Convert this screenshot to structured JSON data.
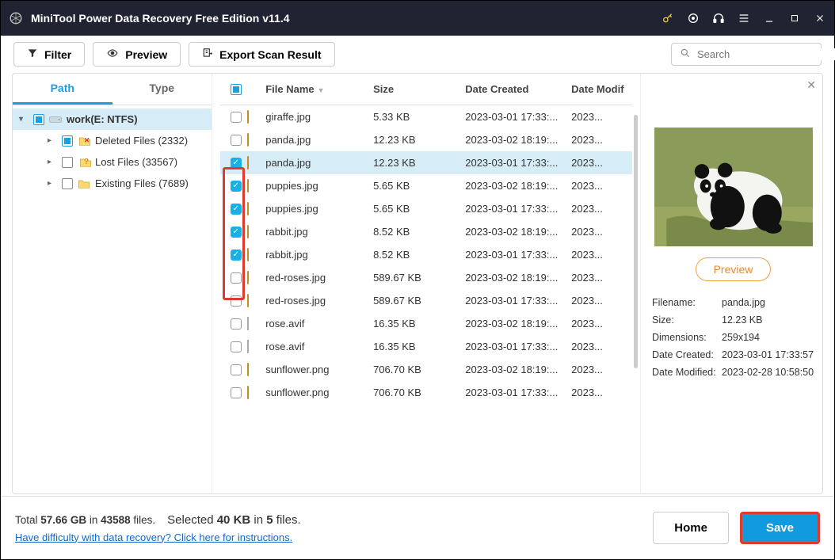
{
  "title": "MiniTool Power Data Recovery Free Edition v11.4",
  "toolbar": {
    "filter": "Filter",
    "preview": "Preview",
    "export": "Export Scan Result"
  },
  "search": {
    "placeholder": "Search"
  },
  "tabs": {
    "path": "Path",
    "type": "Type"
  },
  "tree": {
    "root": "work(E: NTFS)",
    "deleted": "Deleted Files (2332)",
    "lost": "Lost Files (33567)",
    "existing": "Existing Files (7689)"
  },
  "cols": {
    "name": "File Name",
    "size": "Size",
    "created": "Date Created",
    "modified": "Date Modif"
  },
  "files": [
    {
      "name": "giraffe.jpg",
      "size": "5.33 KB",
      "created": "2023-03-01 17:33:...",
      "modified": "2023...",
      "type": "img",
      "checked": false,
      "sel": false
    },
    {
      "name": "panda.jpg",
      "size": "12.23 KB",
      "created": "2023-03-02 18:19:...",
      "modified": "2023...",
      "type": "img",
      "checked": false,
      "sel": false
    },
    {
      "name": "panda.jpg",
      "size": "12.23 KB",
      "created": "2023-03-01 17:33:...",
      "modified": "2023...",
      "type": "img",
      "checked": true,
      "sel": true
    },
    {
      "name": "puppies.jpg",
      "size": "5.65 KB",
      "created": "2023-03-02 18:19:...",
      "modified": "2023...",
      "type": "img",
      "checked": true,
      "sel": false
    },
    {
      "name": "puppies.jpg",
      "size": "5.65 KB",
      "created": "2023-03-01 17:33:...",
      "modified": "2023...",
      "type": "img",
      "checked": true,
      "sel": false
    },
    {
      "name": "rabbit.jpg",
      "size": "8.52 KB",
      "created": "2023-03-02 18:19:...",
      "modified": "2023...",
      "type": "img",
      "checked": true,
      "sel": false
    },
    {
      "name": "rabbit.jpg",
      "size": "8.52 KB",
      "created": "2023-03-01 17:33:...",
      "modified": "2023...",
      "type": "img",
      "checked": true,
      "sel": false
    },
    {
      "name": "red-roses.jpg",
      "size": "589.67 KB",
      "created": "2023-03-02 18:19:...",
      "modified": "2023...",
      "type": "img",
      "checked": false,
      "sel": false
    },
    {
      "name": "red-roses.jpg",
      "size": "589.67 KB",
      "created": "2023-03-01 17:33:...",
      "modified": "2023...",
      "type": "img",
      "checked": false,
      "sel": false
    },
    {
      "name": "rose.avif",
      "size": "16.35 KB",
      "created": "2023-03-02 18:19:...",
      "modified": "2023...",
      "type": "doc",
      "checked": false,
      "sel": false
    },
    {
      "name": "rose.avif",
      "size": "16.35 KB",
      "created": "2023-03-01 17:33:...",
      "modified": "2023...",
      "type": "doc",
      "checked": false,
      "sel": false
    },
    {
      "name": "sunflower.png",
      "size": "706.70 KB",
      "created": "2023-03-02 18:19:...",
      "modified": "2023...",
      "type": "img",
      "checked": false,
      "sel": false
    },
    {
      "name": "sunflower.png",
      "size": "706.70 KB",
      "created": "2023-03-01 17:33:...",
      "modified": "2023...",
      "type": "img",
      "checked": false,
      "sel": false
    }
  ],
  "preview": {
    "button": "Preview",
    "labels": {
      "filename": "Filename:",
      "size": "Size:",
      "dim": "Dimensions:",
      "created": "Date Created:",
      "modified": "Date Modified:"
    },
    "filename": "panda.jpg",
    "size": "12.23 KB",
    "dim": "259x194",
    "created": "2023-03-01 17:33:57",
    "modified": "2023-02-28 10:58:50"
  },
  "footer": {
    "total_prefix": "Total ",
    "total_size": "57.66 GB",
    "total_mid": " in ",
    "total_files": "43588",
    "total_suffix": " files.",
    "sel_prefix": "Selected ",
    "sel_size": "40 KB",
    "sel_mid": " in ",
    "sel_files": "5",
    "sel_suffix": " files.",
    "help": "Have difficulty with data recovery? Click here for instructions.",
    "home": "Home",
    "save": "Save"
  }
}
